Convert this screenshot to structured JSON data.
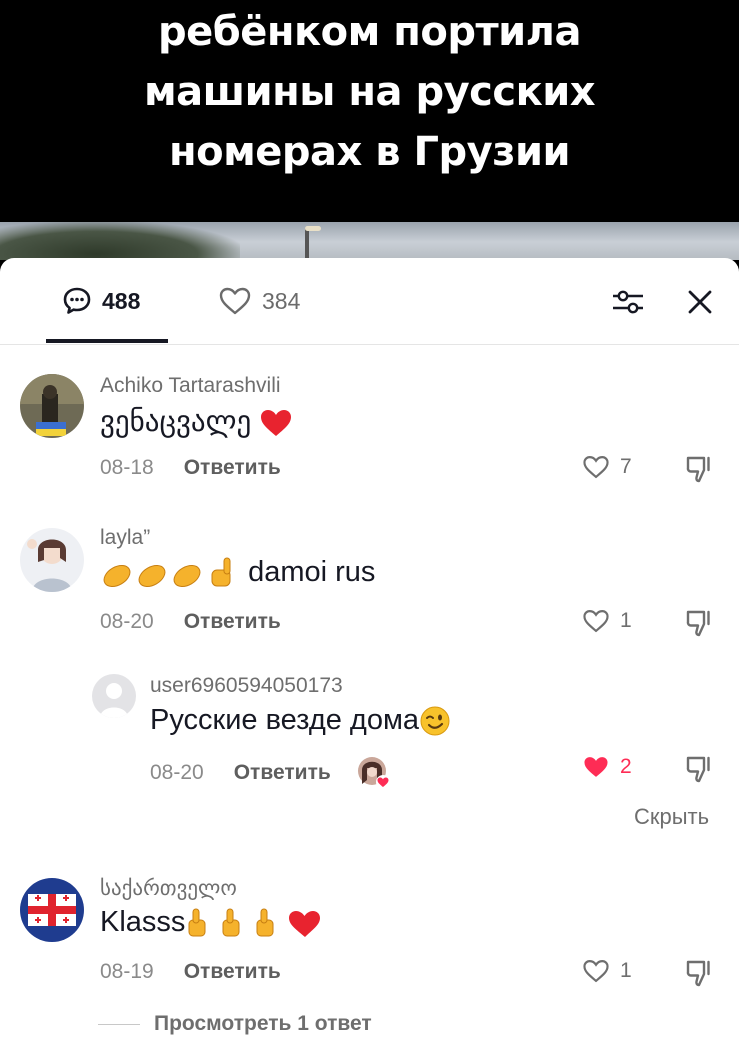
{
  "video": {
    "caption_lines": [
      "ребёнком портила",
      "машины на русских",
      "номерах в Грузии"
    ]
  },
  "tabs": {
    "comments_count": "488",
    "likes_count": "384"
  },
  "comments": [
    {
      "username": "Achiko Tartarashvili",
      "text": "ვენაცვალე ",
      "date": "08-18",
      "reply_label": "Ответить",
      "likes": "7"
    },
    {
      "username": "layla”",
      "text": "damoi rus",
      "date": "08-20",
      "reply_label": "Ответить",
      "likes": "1",
      "replies": [
        {
          "username": "user6960594050173",
          "text": "Русские везде дома",
          "date": "08-20",
          "reply_label": "Ответить",
          "likes": "2",
          "liked": true
        }
      ],
      "hide_label": "Скрыть"
    },
    {
      "username": "საქართველო",
      "text": "Klasss",
      "date": "08-19",
      "reply_label": "Ответить",
      "likes": "1",
      "view_replies_label": "Просмотреть 1 ответ"
    }
  ],
  "colors": {
    "heart_red": "#fe2c55",
    "text_primary": "#161823",
    "text_secondary": "#6e6e6e"
  }
}
